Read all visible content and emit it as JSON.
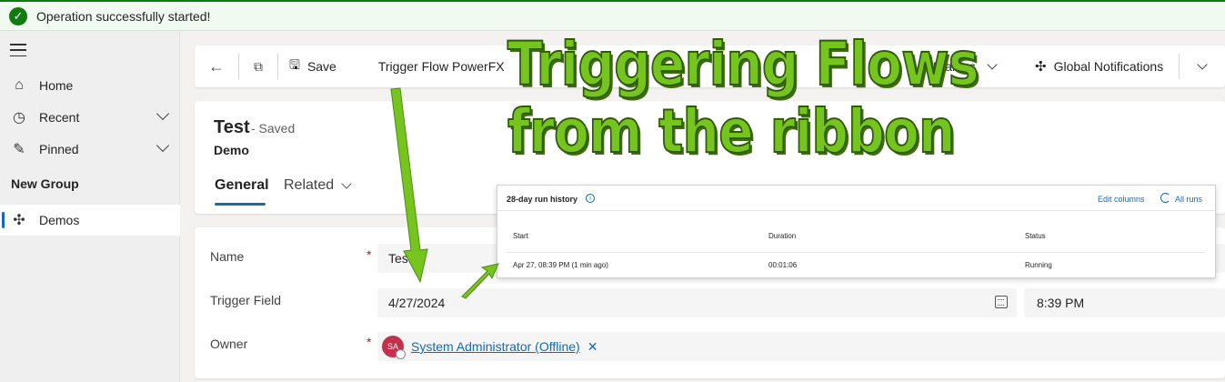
{
  "notification": {
    "text": "Operation successfully started!",
    "icon": "check-circle-icon"
  },
  "sidebar": {
    "items": [
      {
        "label": "Home",
        "icon": "home-icon"
      },
      {
        "label": "Recent",
        "icon": "clock-icon"
      },
      {
        "label": "Pinned",
        "icon": "pin-icon"
      }
    ],
    "group": "New Group",
    "group_items": [
      {
        "label": "Demos",
        "icon": "puzzle-icon"
      }
    ]
  },
  "commandbar": {
    "save": "Save",
    "trigger_flow": "Trigger Flow PowerFX",
    "dialogs": "Dialogs",
    "global_notifications": "Global Notifications"
  },
  "record": {
    "title": "Test",
    "saved_status": "- Saved",
    "entity": "Demo",
    "tabs": {
      "general": "General",
      "related": "Related"
    }
  },
  "form": {
    "name_label": "Name",
    "name_value": "Test",
    "trigger_label": "Trigger Field",
    "trigger_date": "4/27/2024",
    "trigger_time": "8:39 PM",
    "owner_label": "Owner",
    "owner_initials": "SA",
    "owner_name": "System Administrator (Offline)",
    "remove_symbol": "✕",
    "required_marker": "*"
  },
  "run_history": {
    "title": "28-day run history",
    "edit_columns": "Edit columns",
    "all_runs": "All runs",
    "columns": [
      "Start",
      "Duration",
      "Status"
    ],
    "rows": [
      {
        "start": "Apr 27, 08:39 PM (1 min ago)",
        "duration": "00:01:06",
        "status": "Running"
      }
    ]
  },
  "overlay": {
    "line1": "Triggering Flows",
    "line2": "from the ribbon",
    "color": "#76c51f"
  }
}
